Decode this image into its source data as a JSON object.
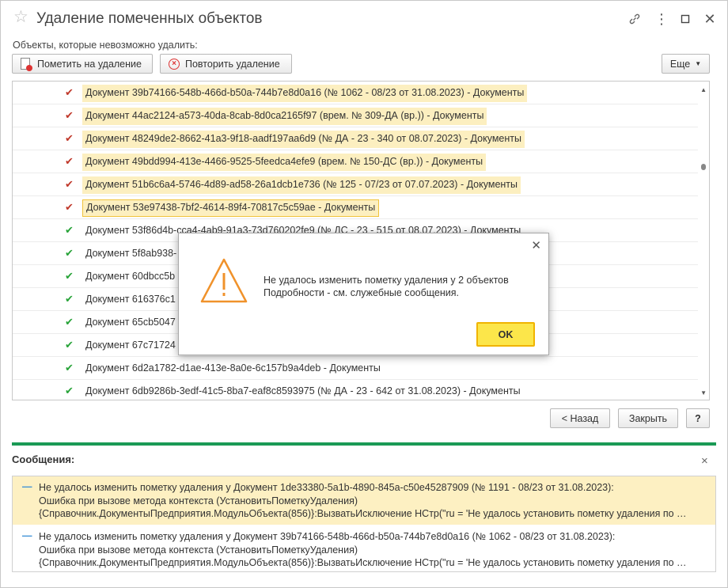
{
  "window": {
    "title": "Удаление помеченных объектов"
  },
  "caption": "Объекты, которые невозможно удалить:",
  "toolbar": {
    "mark_label": "Пометить на удаление",
    "repeat_label": "Повторить удаление",
    "more_label": "Еще"
  },
  "list": {
    "rows": [
      {
        "status": "error",
        "text": "Документ 39b74166-548b-466d-b50a-744b7e8d0a16 (№ 1062 - 08/23 от 31.08.2023) - Документы"
      },
      {
        "status": "error",
        "text": "Документ 44ac2124-a573-40da-8cab-8d0ca2165f97 (врем. № 309-ДА (вр.)) - Документы"
      },
      {
        "status": "error",
        "text": "Документ 48249de2-8662-41a3-9f18-aadf197aa6d9 (№ ДА - 23 - 340 от 08.07.2023) - Документы"
      },
      {
        "status": "error",
        "text": "Документ 49bdd994-413e-4466-9525-5feedca4efe9 (врем. № 150-ДС (вр.)) - Документы"
      },
      {
        "status": "error",
        "text": "Документ 51b6c6a4-5746-4d89-ad58-26a1dcb1e736 (№ 125 - 07/23 от 07.07.2023) - Документы"
      },
      {
        "status": "error",
        "text": "Документ 53e97438-7bf2-4614-89f4-70817c5c59ae - Документы"
      },
      {
        "status": "ok",
        "text": "Документ 53f86d4b-cca4-4ab9-91a3-73d760202fe9 (№ ДС - 23 - 515 от 08.07.2023) - Документы"
      },
      {
        "status": "ok",
        "text": "Документ 5f8ab938-"
      },
      {
        "status": "ok",
        "text": "Документ 60dbcc5b"
      },
      {
        "status": "ok",
        "text": "Документ 616376c1"
      },
      {
        "status": "ok",
        "text": "Документ 65cb5047"
      },
      {
        "status": "ok",
        "text": "Документ 67c71724"
      },
      {
        "status": "ok",
        "text": "Документ 6d2a1782-d1ae-413e-8a0e-6c157b9a4deb - Документы"
      },
      {
        "status": "ok",
        "text": "Документ 6db9286b-3edf-41c5-8ba7-eaf8c8593975 (№ ДА - 23 - 642 от 31.08.2023) - Документы"
      }
    ]
  },
  "nav": {
    "back_label": "< Назад",
    "close_label": "Закрыть",
    "help_label": "?"
  },
  "messages": {
    "title": "Сообщения:",
    "items": [
      {
        "line1": "Не удалось изменить пометку удаления у Документ 1de33380-5a1b-4890-845a-c50e45287909 (№ 1191 - 08/23 от 31.08.2023):",
        "line2": "Ошибка при вызове метода контекста (УстановитьПометкуУдаления)",
        "line3": "{Справочник.ДокументыПредприятия.МодульОбъекта(856)}:ВызватьИсключение НСтр(\"ru = 'Не удалось установить пометку удаления по …"
      },
      {
        "line1": "Не удалось изменить пометку удаления у Документ 39b74166-548b-466d-b50a-744b7e8d0a16 (№ 1062 - 08/23 от 31.08.2023):",
        "line2": "Ошибка при вызове метода контекста (УстановитьПометкуУдаления)",
        "line3": "{Справочник.ДокументыПредприятия.МодульОбъекта(856)}:ВызватьИсключение НСтр(\"ru = 'Не удалось установить пометку удаления по …"
      }
    ]
  },
  "dialog": {
    "line1": "Не удалось изменить пометку удаления у 2 объектов",
    "line2": "Подробности - см. служебные сообщения.",
    "ok_label": "OK"
  },
  "colors": {
    "accent_green": "#1a9a55",
    "highlight": "#fcefc0",
    "ok_button": "#fce64a",
    "warning": "#f0922b"
  }
}
